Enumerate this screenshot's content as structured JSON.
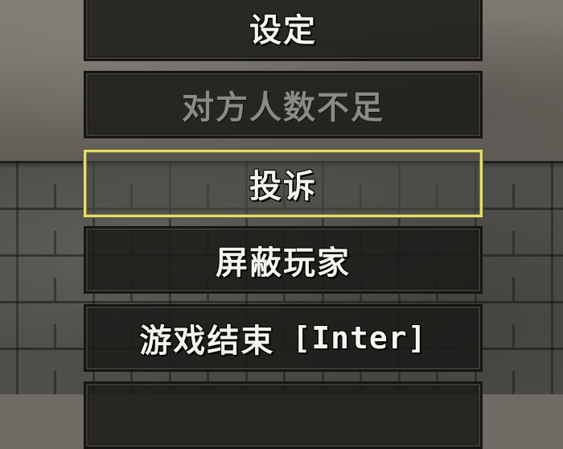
{
  "menu": {
    "items": [
      {
        "label": "设定",
        "state": "normal"
      },
      {
        "label": "对方人数不足",
        "state": "disabled"
      },
      {
        "label": "投诉",
        "state": "selected"
      },
      {
        "label": "屏蔽玩家",
        "state": "normal"
      },
      {
        "label": "游戏结束",
        "shortcut": "[Inter]",
        "state": "normal"
      },
      {
        "label": "",
        "state": "normal"
      }
    ]
  },
  "colors": {
    "text": "#f4f3ee",
    "disabled_text": "#8b8a86",
    "selected_border": "#e5dc6e",
    "button_fill": "#1c1b19"
  }
}
